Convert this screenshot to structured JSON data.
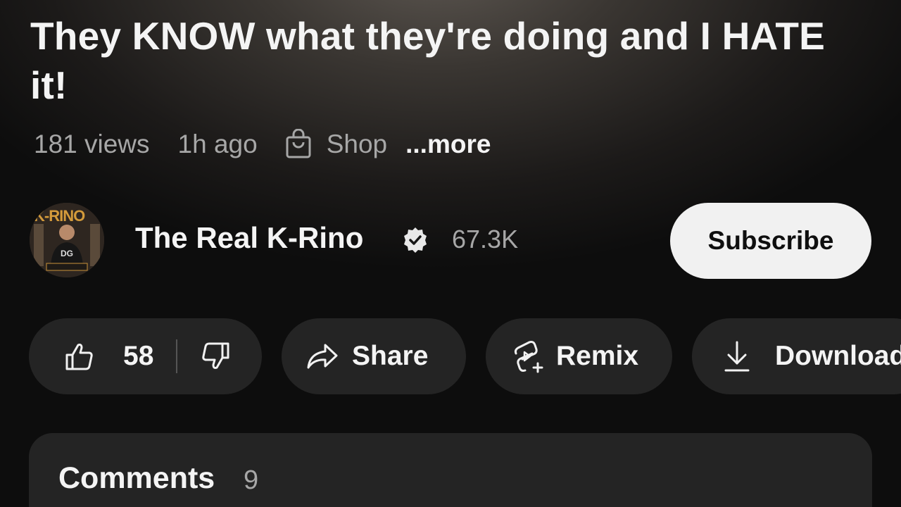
{
  "video": {
    "title": "They KNOW what they're doing and I HATE it!",
    "views": "181 views",
    "age": "1h ago",
    "shop_label": "Shop",
    "more_label": "...more"
  },
  "channel": {
    "avatar_text": "K-RINO",
    "name": "The Real K-Rino",
    "subscriber_count": "67.3K",
    "subscribe_label": "Subscribe"
  },
  "actions": {
    "like_count": "58",
    "share_label": "Share",
    "remix_label": "Remix",
    "download_label": "Download"
  },
  "comments": {
    "title": "Comments",
    "count": "9"
  },
  "icons": {
    "shop": "shopping-bag-icon",
    "verified": "verified-badge-icon",
    "like": "thumbs-up-icon",
    "dislike": "thumbs-down-icon",
    "share": "share-arrow-icon",
    "remix": "remix-icon",
    "download": "download-icon"
  },
  "colors": {
    "background": "#0b0b0b",
    "pill": "#242424",
    "subscribe_bg": "#f1f1f1",
    "secondary_text": "#a7a7a7",
    "primary_text": "#f4f4f4"
  }
}
